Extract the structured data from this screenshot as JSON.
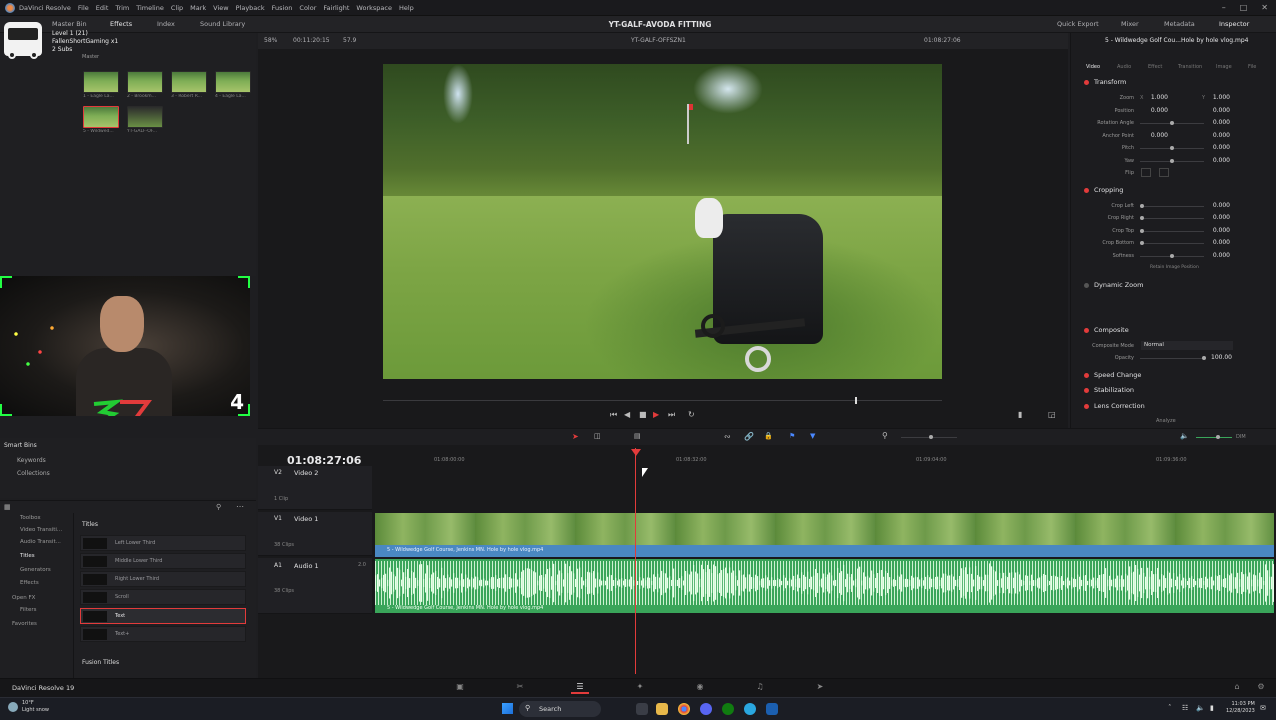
{
  "menubar": {
    "app": "DaVinci Resolve",
    "items": [
      "File",
      "Edit",
      "Trim",
      "Timeline",
      "Clip",
      "Mark",
      "View",
      "Playback",
      "Fusion",
      "Color",
      "Fairlight",
      "Workspace",
      "Help"
    ]
  },
  "toolbar": {
    "left": [
      "Master Bin",
      "Effects",
      "Index",
      "Sound Library"
    ],
    "project_title": "YT-GALF-AVODA FITTING",
    "right": [
      "Quick Export",
      "Mixer",
      "Metadata",
      "Inspector"
    ]
  },
  "stream_overlay": {
    "line1": "Level 1 (21)",
    "line2": "FallenShortGaming x1",
    "line3": "2 Subs"
  },
  "media_pool": {
    "bin_label": "Master",
    "clips": [
      "1 - Eagle La...",
      "2 - Brookm...",
      "3 - Robert R...",
      "4 - Eagle La...",
      "5 - Wildwed...",
      "YT-GALF-OF..."
    ]
  },
  "webcam": {
    "number": "4"
  },
  "smart_bins": {
    "title": "Smart Bins",
    "items": [
      "Keywords",
      "Collections"
    ]
  },
  "effects": {
    "tree": [
      "Toolbox",
      "Video Transiti...",
      "Audio Transit...",
      "Titles",
      "Generators",
      "Effects",
      "Open FX",
      "Filters",
      "Favorites"
    ],
    "section": "Titles",
    "items": [
      "Left Lower Third",
      "Middle Lower Third",
      "Right Lower Third",
      "Scroll",
      "Text",
      "Text+"
    ],
    "footer": "Fusion Titles"
  },
  "viewer": {
    "zoom": "58%",
    "timecode_left": "00:11:20:15",
    "fps": "57.9",
    "timeline_name": "YT-GALF-OFFSZN1",
    "timecode_right": "01:08:27:06"
  },
  "inspector": {
    "clip_title": "5 - Wildwedge Golf Cou...Hole by hole vlog.mp4",
    "tabs": [
      "Video",
      "Audio",
      "Effect",
      "Transition",
      "Image",
      "File"
    ],
    "transform": {
      "title": "Transform",
      "props": [
        {
          "label": "Zoom",
          "x": "1.000",
          "y": "1.000"
        },
        {
          "label": "Position",
          "x": "0.000",
          "y": "0.000"
        },
        {
          "label": "Rotation Angle",
          "v": "0.000"
        },
        {
          "label": "Anchor Point",
          "x": "0.000",
          "y": "0.000"
        },
        {
          "label": "Pitch",
          "v": "0.000"
        },
        {
          "label": "Yaw",
          "v": "0.000"
        },
        {
          "label": "Flip",
          "v": ""
        }
      ]
    },
    "cropping": {
      "title": "Cropping",
      "props": [
        {
          "label": "Crop Left",
          "v": "0.000"
        },
        {
          "label": "Crop Right",
          "v": "0.000"
        },
        {
          "label": "Crop Top",
          "v": "0.000"
        },
        {
          "label": "Crop Bottom",
          "v": "0.000"
        },
        {
          "label": "Softness",
          "v": "0.000"
        }
      ],
      "retain": "Retain Image Position"
    },
    "dynamic_zoom": "Dynamic Zoom",
    "composite": {
      "title": "Composite",
      "mode_label": "Composite Mode",
      "mode_value": "Normal",
      "opacity_label": "Opacity",
      "opacity_value": "100.00"
    },
    "sections": [
      "Speed Change",
      "Stabilization",
      "Lens Correction"
    ],
    "analyze": "Analyze"
  },
  "timeline": {
    "timecode": "01:08:27:06",
    "ruler": [
      "01:08:00:00",
      "01:08:32:00",
      "01:09:04:00",
      "01:09:36:00"
    ],
    "tracks": [
      {
        "id": "V2",
        "name": "Video 2",
        "clips": "1 Clip"
      },
      {
        "id": "V1",
        "name": "Video 1",
        "clips": "38 Clips"
      },
      {
        "id": "A1",
        "name": "Audio 1",
        "clips": "38 Clips",
        "ch": "2.0"
      }
    ],
    "clip_name": "5 - Wildwedge Golf Course, Jenkins MN. Hole by hole vlog.mp4"
  },
  "pagebar": {
    "brand": "DaVinci Resolve 19"
  },
  "taskbar": {
    "weather_temp": "10°F",
    "weather_desc": "Light snow",
    "search": "Search",
    "time": "11:03 PM",
    "date": "12/28/2023"
  }
}
